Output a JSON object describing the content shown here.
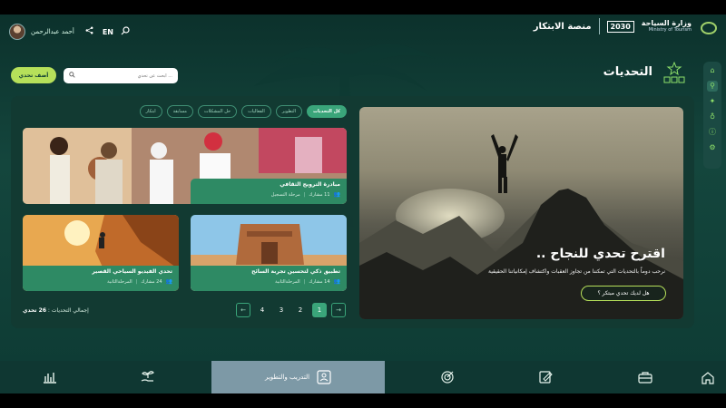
{
  "header": {
    "user_name": "أحمد عبدالرحمن",
    "lang": "EN",
    "platform_name": "منصة الابتكار",
    "vision_text": "2030",
    "ministry_ar": "وزارة السياحة",
    "ministry_en": "Ministry of Tourism",
    "icons": [
      "share-icon",
      "search-icon"
    ]
  },
  "page": {
    "title": "التحديات",
    "suggest_button": "أضف تحدي",
    "search_placeholder": "ابحث عن تحدي ..."
  },
  "side_rail": {
    "items": [
      "home-icon",
      "hierarchy-icon",
      "bulb-icon",
      "lightbulb-icon",
      "info-icon",
      "gear-icon"
    ],
    "active_index": 1
  },
  "filters": {
    "items": [
      "كل التحديات",
      "التطوير",
      "الفعاليات",
      "حل المشكلات",
      "مسابقة",
      "ابتكار"
    ],
    "active_index": 0
  },
  "hero": {
    "title": "اقترح تحدي للنجاح ..",
    "subtitle": "نرحب دوماً بالتحديات التي تمكننا من تجاوز العقبات واكتشاف إمكانياتنا الحقيقية",
    "button": "هل لديك تحدي مبتكر ؟"
  },
  "cards": [
    {
      "title": "مبادرة الترويج الثقافي",
      "participants": "11 مشارك",
      "status": "مرحلة التسجيل"
    },
    {
      "title": "تطبيق ذكي لتحسين تجربة السائح",
      "participants": "14 مشارك",
      "status": "المرحلةالثانية"
    },
    {
      "title": "تحدي الفيديو السياحي القصير",
      "participants": "24 مشارك",
      "status": "المرحلةالثانية"
    }
  ],
  "pagination": {
    "total_label": "إجمالي التحديات :",
    "total_count": "26 تحدي",
    "pages": [
      "1",
      "2",
      "3",
      "4"
    ],
    "active_page": "1"
  },
  "bottom_nav": {
    "items": [
      "home-icon",
      "briefcase-icon",
      "edit-doc-icon",
      "target-icon",
      "training-icon",
      "plant-hand-icon",
      "chart-icon"
    ],
    "active_label": "التدريب والتطوير"
  },
  "colors": {
    "accent": "#b6e05a",
    "primary_green": "#3aa57a",
    "background": "#0f3f37"
  }
}
